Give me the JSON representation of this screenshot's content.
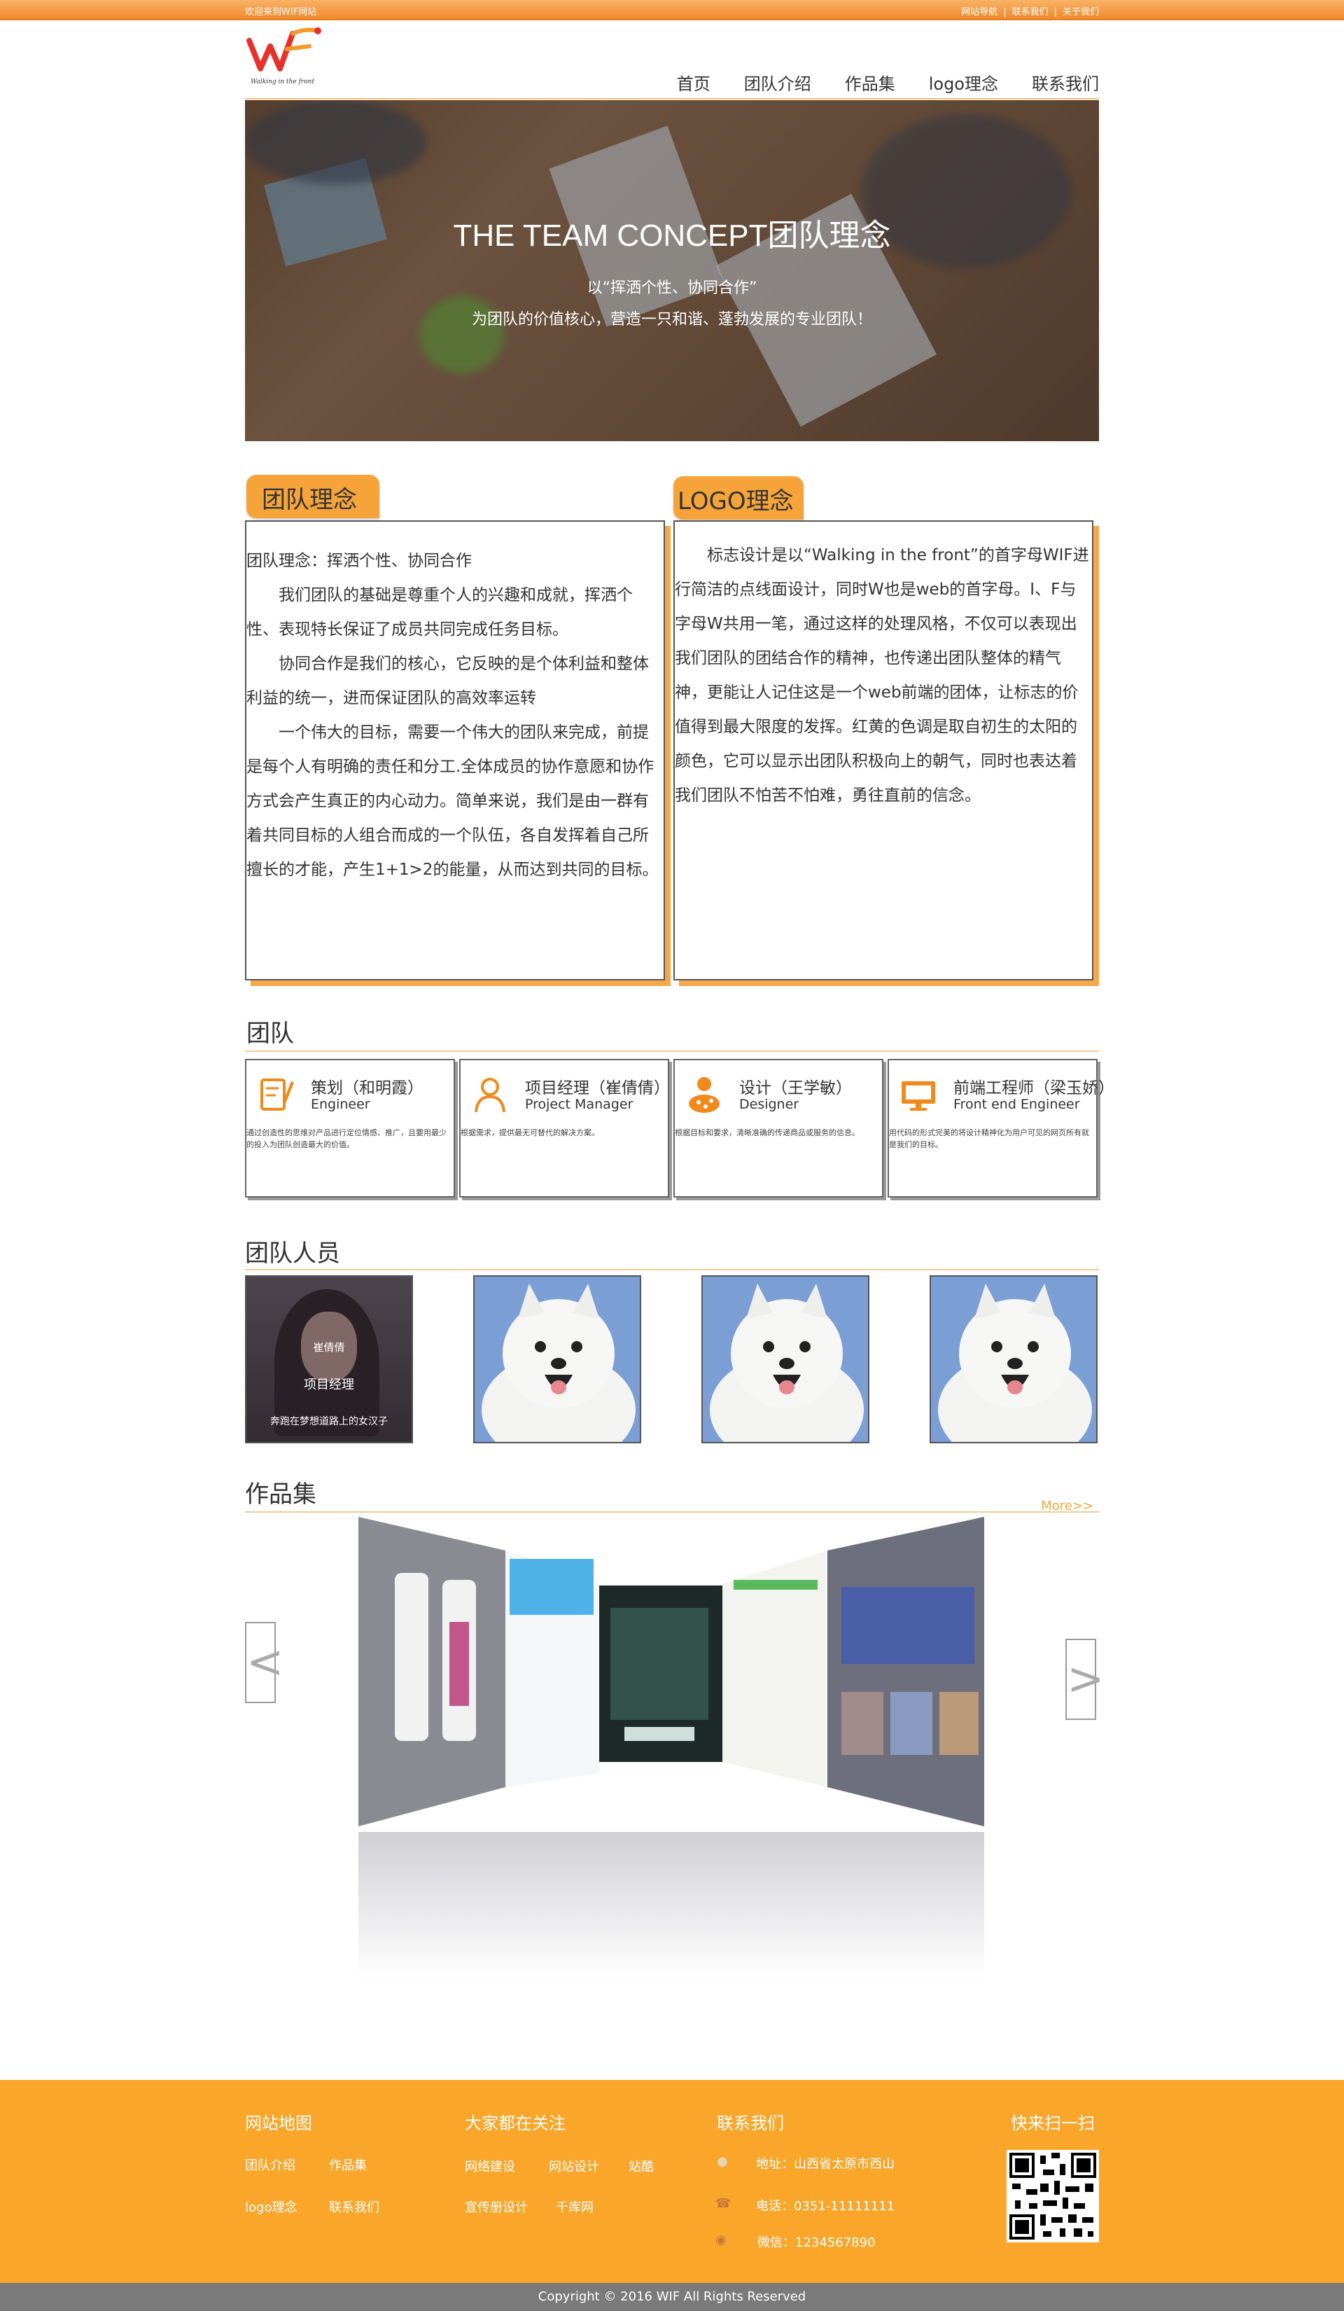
{
  "topbar": {
    "welcome": "欢迎来到WIF网站",
    "links": [
      "网站导航",
      "联系我们",
      "关于我们"
    ],
    "separator": "|"
  },
  "logo": {
    "tagline": "Walking in the front"
  },
  "nav": [
    "首页",
    "团队介绍",
    "作品集",
    "logo理念",
    "联系我们"
  ],
  "hero": {
    "title": "THE TEAM CONCEPT团队理念",
    "line1": "以“挥洒个性、协同合作”",
    "line2": "为团队的价值核心，营造一只和谐、蓬勃发展的专业团队！"
  },
  "concept": {
    "tab": "团队理念",
    "paragraphs": [
      "团队理念：挥洒个性、协同合作",
      "我们团队的基础是尊重个人的兴趣和成就，挥洒个性、表现特长保证了成员共同完成任务目标。",
      "协同合作是我们的核心，它反映的是个体利益和整体利益的统一，进而保证团队的高效率运转",
      "一个伟大的目标，需要一个伟大的团队来完成，前提是每个人有明确的责任和分工.全体成员的协作意愿和协作方式会产生真正的内心动力。简单来说，我们是由一群有着共同目标的人组合而成的一个队伍，各自发挥着自己所擅长的才能，产生1+1>2的能量，从而达到共同的目标。"
    ]
  },
  "logo_concept": {
    "tab": "LOGO理念",
    "text": "标志设计是以“Walking in the front”的首字母WIF进行简洁的点线面设计，同时W也是web的首字母。I、F与字母W共用一笔，通过这样的处理风格，不仅可以表现出我们团队的团结合作的精神，也传递出团队整体的精气神，更能让人记住这是一个web前端的团体，让标志的价值得到最大限度的发挥。红黄的色调是取自初生的太阳的颜色，它可以显示出团队积极向上的朝气，同时也表达着我们团队不怕苦不怕难，勇往直前的信念。"
  },
  "team": {
    "heading": "团队",
    "roles": [
      {
        "title": "策划（和明霞）",
        "en": "Engineer",
        "desc": "通过创造性的思维对产品进行定位情感、推广，且要用最少的投入为团队创造最大的价值。",
        "icon": "pen-paper-icon"
      },
      {
        "title": "项目经理（崔倩倩）",
        "en": "Project Manager",
        "desc": "根据需求，提供最无可替代的解决方案。",
        "icon": "user-icon"
      },
      {
        "title": "设计（王学敏）",
        "en": "Designer",
        "desc": "根据目标和要求，清晰准确的传递商品或服务的信息。",
        "icon": "palette-user-icon"
      },
      {
        "title": "前端工程师（梁玉娇）",
        "en": "Front end Engineer",
        "desc": "用代码的形式完美的将设计精神化为用户可见的网页所有就是我们的目标。",
        "icon": "monitor-icon"
      }
    ]
  },
  "members": {
    "heading": "团队人员",
    "first": {
      "name": "崔倩倩",
      "role": "项目经理",
      "motto": "奔跑在梦想道路上的女汉子"
    }
  },
  "works": {
    "heading": "作品集",
    "more": "More>>",
    "prev": "<",
    "next": ">"
  },
  "footer": {
    "sitemap": {
      "title": "网站地图",
      "links": [
        "团队介绍",
        "作品集",
        "logo理念",
        "联系我们"
      ]
    },
    "focus": {
      "title": "大家都在关注",
      "links": [
        "网络建设",
        "网站设计",
        "站酷",
        "宣传册设计",
        "千库网"
      ]
    },
    "contact": {
      "title": "联系我们",
      "address": "地址：山西省太原市西山",
      "phone": "电话：0351-11111111",
      "wechat": "微信：1234567890"
    },
    "scan": {
      "title": "快来扫一扫"
    },
    "copyright": "Copyright © 2016 WIF All Rights Reserved"
  },
  "colors": {
    "accent": "#f6a43a",
    "footer": "#f9a62b",
    "topbar": "#f08a2c"
  }
}
